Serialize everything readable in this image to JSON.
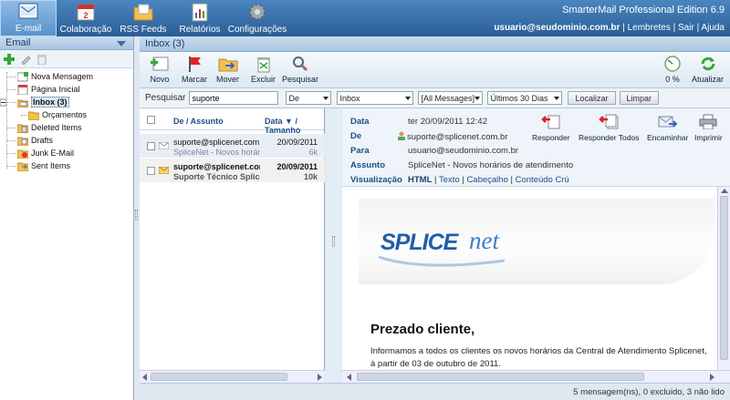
{
  "app": {
    "edition": "SmarterMail Professional Edition 6.9",
    "user": "usuario@seudominio.com.br",
    "links": [
      "Lembretes",
      "Sair",
      "Ajuda"
    ]
  },
  "topnav": [
    {
      "label": "E-mail",
      "icon": "email-icon"
    },
    {
      "label": "Colaboração",
      "icon": "calendar-icon"
    },
    {
      "label": "RSS Feeds",
      "icon": "folder-icon"
    },
    {
      "label": "Relatórios",
      "icon": "report-icon"
    },
    {
      "label": "Configurações",
      "icon": "gear-icon"
    }
  ],
  "left": {
    "title": "Email",
    "tree": [
      {
        "label": "Nova Mensagem",
        "icon": "new-message-icon"
      },
      {
        "label": "Página Inicial",
        "icon": "home-page-icon"
      },
      {
        "label": "Inbox (3)",
        "icon": "inbox-icon"
      },
      {
        "label": "Orçamentos",
        "icon": "folder-icon"
      },
      {
        "label": "Deleted Items",
        "icon": "deleted-items-icon"
      },
      {
        "label": "Drafts",
        "icon": "drafts-icon"
      },
      {
        "label": "Junk E-Mail",
        "icon": "junk-icon"
      },
      {
        "label": "Sent Items",
        "icon": "sent-items-icon"
      }
    ]
  },
  "inbox": {
    "title": "Inbox (3)"
  },
  "toolbar": {
    "buttons": [
      "Novo",
      "Marcar",
      "Mover",
      "Excluir",
      "Pesquisar"
    ],
    "quota": "0 %",
    "refresh": "Atualizar"
  },
  "search": {
    "label": "Pesquisar",
    "value": "suporte",
    "field": "De",
    "folder": "Inbox",
    "type": "[All Messages]",
    "period": "Últimos 30 Dias",
    "find": "Localizar",
    "clear": "Limpar"
  },
  "list": {
    "col_from": "De / Assunto",
    "col_date": "Data",
    "col_size": "/ Tamanho",
    "rows": [
      {
        "from": "suporte@splicenet.com.br",
        "subject": "SpliceNet - Novos horários de atendimento",
        "date": "20/09/2011",
        "size": "6k",
        "unread": false
      },
      {
        "from": "suporte@splicenet.com.br",
        "subject": "Suporte Técnico Splicenet",
        "date": "20/09/2011",
        "size": "10k",
        "unread": true
      }
    ]
  },
  "message": {
    "labels": {
      "date": "Data",
      "from": "De",
      "to": "Para",
      "subject": "Assunto",
      "view": "Visualização"
    },
    "date": "ter 20/09/2011 12:42",
    "from": "suporte@splicenet.com.br",
    "to": "usuario@seudominio.com.br",
    "subject": "SpliceNet - Novos horários de atendimento",
    "view_modes": [
      "HTML",
      "Texto",
      "Cabeçalho",
      "Conteúdo Crú"
    ],
    "actions": [
      "Responder",
      "Responder Todos",
      "Encaminhar",
      "Imprimir"
    ],
    "body": {
      "logo_text": "SPLICEnet",
      "greeting": "Prezado cliente,",
      "paragraph1": "Informamos a todos os clientes os novos horários da Central de Atendimento Splicenet,",
      "paragraph2": "à partir de 03 de outubro de 2011."
    }
  },
  "status": "5 mensagem(ns), 0 excluido, 3 não lido"
}
